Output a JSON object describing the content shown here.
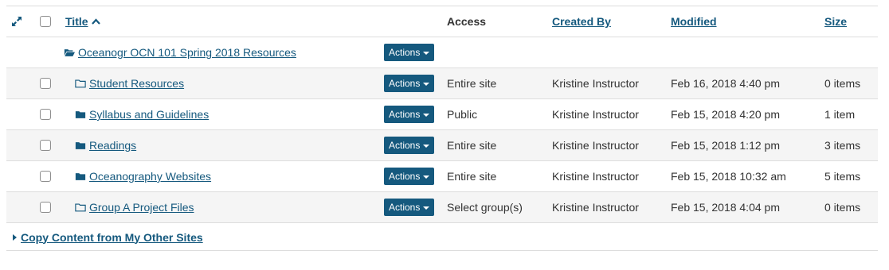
{
  "header": {
    "title": "Title",
    "title_sort_icon": "chevron-up-icon",
    "access": "Access",
    "created_by": "Created By",
    "modified": "Modified",
    "size": "Size"
  },
  "colors": {
    "link": "#15597e",
    "button_bg": "#15597e",
    "stripe": "#f5f5f5",
    "border": "#dddddd"
  },
  "parent_folder": {
    "name": "Oceanogr OCN 101 Spring 2018 Resources",
    "icon": "folder-open-icon",
    "actions_label": "Actions"
  },
  "rows": [
    {
      "name": "Student Resources",
      "icon": "folder-outline-icon",
      "actions_label": "Actions",
      "access": "Entire site",
      "created_by": "Kristine Instructor",
      "modified": "Feb 16, 2018 4:40 pm",
      "size": "0 items"
    },
    {
      "name": "Syllabus and Guidelines",
      "icon": "folder-filled-icon",
      "actions_label": "Actions",
      "access": "Public",
      "created_by": "Kristine Instructor",
      "modified": "Feb 15, 2018 4:20 pm",
      "size": "1 item"
    },
    {
      "name": "Readings",
      "icon": "folder-filled-icon",
      "actions_label": "Actions",
      "access": "Entire site",
      "created_by": "Kristine Instructor",
      "modified": "Feb 15, 2018 1:12 pm",
      "size": "3 items"
    },
    {
      "name": "Oceanography Websites",
      "icon": "folder-filled-icon",
      "actions_label": "Actions",
      "access": "Entire site",
      "created_by": "Kristine Instructor",
      "modified": "Feb 15, 2018 10:32 am",
      "size": "5 items"
    },
    {
      "name": "Group A Project Files",
      "icon": "folder-outline-icon",
      "actions_label": "Actions",
      "access": "Select group(s)",
      "created_by": "Kristine Instructor",
      "modified": "Feb 15, 2018 4:04 pm",
      "size": "0 items"
    }
  ],
  "footer": {
    "copy_content_label": "Copy Content from My Other Sites"
  }
}
